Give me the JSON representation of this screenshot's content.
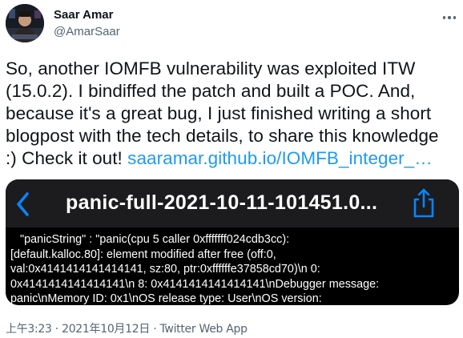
{
  "author": {
    "name": "Saar Amar",
    "handle": "@AmarSaar"
  },
  "tweet": {
    "lines": [
      "So, another IOMFB vulnerability was exploited ITW",
      "(15.0.2). I bindiffed the patch and built a POC. And,",
      "because it's a great bug, I just finished writing a short",
      "blogpost with the tech details, to share this knowledge"
    ],
    "last_line_text": ":) Check it out! ",
    "link_text": "saaramar.github.io/IOMFB_integer_…"
  },
  "media": {
    "title": "panic-full-2021-10-11-101451.0...",
    "panic_lines": [
      "\"panicString\" : \"panic(cpu 5 caller 0xfffffff024cdb3cc):",
      "[default.kalloc.80]: element modified after free (off:0,",
      "val:0x4141414141414141, sz:80, ptr:0xffffffe37858cd70)\\n    0:",
      "0x4141414141414141\\n    8: 0x4141414141414141\\nDebugger message:",
      "panic\\nMemory ID: 0x1\\nOS release type: User\\nOS version:"
    ]
  },
  "meta": {
    "timestamp": "上午3:23 · 2021年10月12日 · Twitter Web App"
  },
  "colors": {
    "link": "#1d9bf0",
    "ios_blue": "#0a84ff",
    "secondary_text": "#536471"
  },
  "icons": {
    "more": "more-horizontal-icon",
    "back": "chevron-left-icon",
    "share": "share-icon"
  }
}
